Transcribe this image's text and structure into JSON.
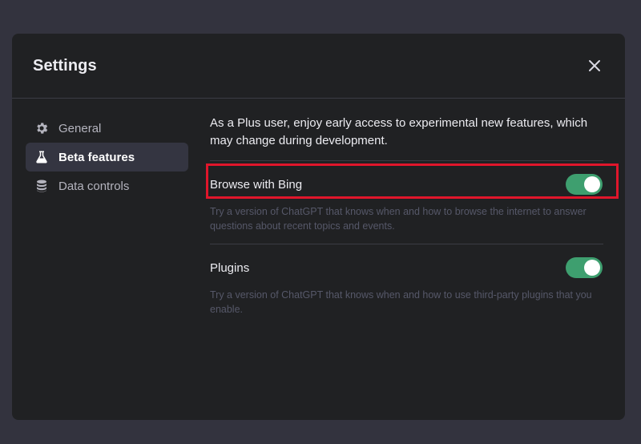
{
  "modal": {
    "title": "Settings"
  },
  "sidebar": {
    "items": [
      {
        "label": "General",
        "icon": "gear-icon",
        "active": false
      },
      {
        "label": "Beta features",
        "icon": "flask-icon",
        "active": true
      },
      {
        "label": "Data controls",
        "icon": "database-icon",
        "active": false
      }
    ]
  },
  "content": {
    "intro": "As a Plus user, enjoy early access to experimental new features, which may change during development.",
    "features": [
      {
        "label": "Browse with Bing",
        "description": "Try a version of ChatGPT that knows when and how to browse the internet to answer questions about recent topics and events.",
        "enabled": true,
        "highlighted": true
      },
      {
        "label": "Plugins",
        "description": "Try a version of ChatGPT that knows when and how to use third-party plugins that you enable.",
        "enabled": true,
        "highlighted": false
      }
    ]
  },
  "colors": {
    "background": "#33333e",
    "modal": "#202123",
    "toggle_on": "#3e9f6f",
    "highlight_border": "#e0162b"
  }
}
